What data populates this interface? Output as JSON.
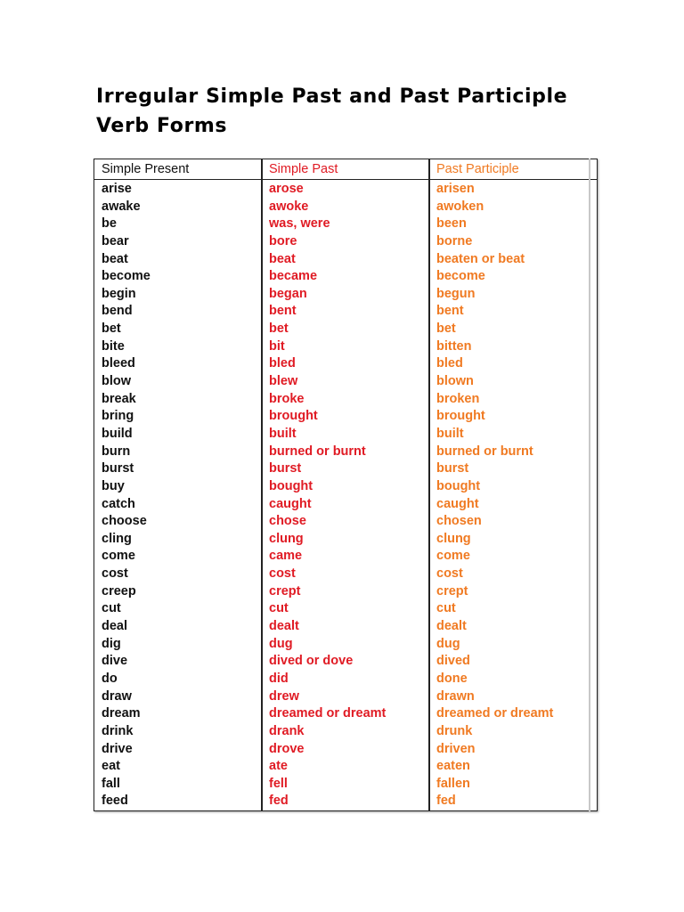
{
  "document": {
    "title": "Irregular Simple Past and Past Participle Verb Forms",
    "title_line1": "Irregular Simple Past and Past Participle",
    "title_line2": "Verb Forms"
  },
  "colors": {
    "present": "#111111",
    "past": "#e01b24",
    "participle": "#f07a22"
  },
  "table": {
    "headers": [
      "Simple Present",
      "Simple Past",
      "Past Participle"
    ],
    "rows": [
      [
        "arise",
        "arose",
        "arisen"
      ],
      [
        "awake",
        "awoke",
        "awoken"
      ],
      [
        "be",
        "was, were",
        "been"
      ],
      [
        "bear",
        "bore",
        "borne"
      ],
      [
        "beat",
        "beat",
        "beaten or beat"
      ],
      [
        "become",
        "became",
        "become"
      ],
      [
        "begin",
        "began",
        "begun"
      ],
      [
        "bend",
        "bent",
        "bent"
      ],
      [
        "bet",
        "bet",
        "bet"
      ],
      [
        "bite",
        "bit",
        "bitten"
      ],
      [
        "bleed",
        "bled",
        "bled"
      ],
      [
        "blow",
        "blew",
        "blown"
      ],
      [
        "break",
        "broke",
        "broken"
      ],
      [
        "bring",
        "brought",
        "brought"
      ],
      [
        "build",
        "built",
        "built"
      ],
      [
        "burn",
        "burned or burnt",
        "burned or burnt"
      ],
      [
        "burst",
        "burst",
        "burst"
      ],
      [
        "buy",
        "bought",
        "bought"
      ],
      [
        "catch",
        "caught",
        "caught"
      ],
      [
        "choose",
        "chose",
        "chosen"
      ],
      [
        "cling",
        "clung",
        "clung"
      ],
      [
        "come",
        "came",
        "come"
      ],
      [
        "cost",
        "cost",
        "cost"
      ],
      [
        "creep",
        "crept",
        "crept"
      ],
      [
        "cut",
        "cut",
        "cut"
      ],
      [
        "deal",
        "dealt",
        "dealt"
      ],
      [
        "dig",
        "dug",
        "dug"
      ],
      [
        "dive",
        "dived or dove",
        "dived"
      ],
      [
        "do",
        "did",
        "done"
      ],
      [
        "draw",
        "drew",
        "drawn"
      ],
      [
        "dream",
        "dreamed or dreamt",
        "dreamed or dreamt"
      ],
      [
        "drink",
        "drank",
        "drunk"
      ],
      [
        "drive",
        "drove",
        "driven"
      ],
      [
        "eat",
        "ate",
        "eaten"
      ],
      [
        "fall",
        "fell",
        "fallen"
      ],
      [
        "feed",
        "fed",
        "fed"
      ]
    ]
  }
}
